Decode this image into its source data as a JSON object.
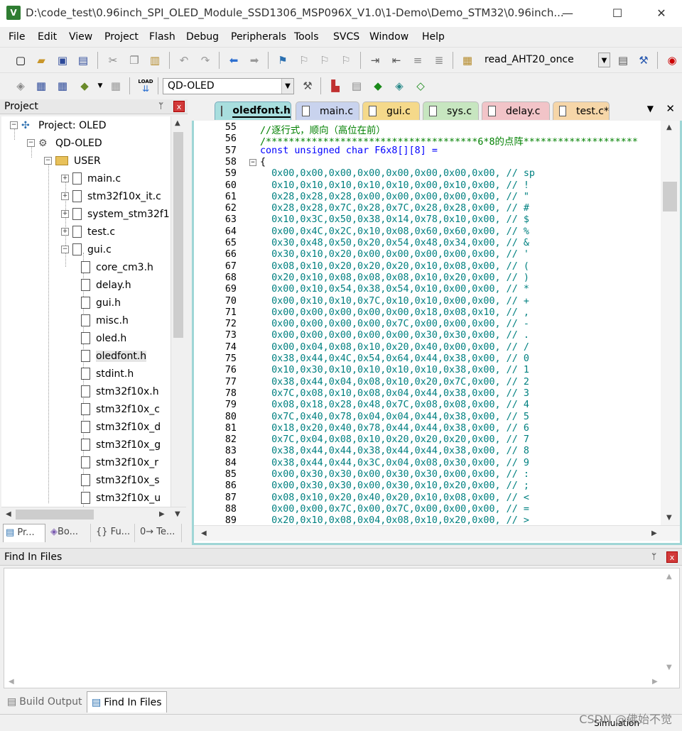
{
  "window": {
    "app_icon": "V",
    "title": "D:\\code_test\\0.96inch_SPI_OLED_Module_SSD1306_MSP096X_V1.0\\1-Demo\\Demo_STM32\\0.96inch...",
    "minimize": "—",
    "maximize": "☐",
    "close": "✕"
  },
  "menu": [
    "File",
    "Edit",
    "View",
    "Project",
    "Flash",
    "Debug",
    "Peripherals",
    "Tools",
    "SVCS",
    "Window",
    "Help"
  ],
  "toolbar1": {
    "target_combo": "read_AHT20_once"
  },
  "toolbar2": {
    "load_label": "LOAD",
    "target_combo": "QD-OLED"
  },
  "project_panel": {
    "title": "Project",
    "pin": "ᛘ",
    "close": "x",
    "tree": [
      {
        "label": "Project: OLED",
        "kind": "project",
        "expander": "−"
      },
      {
        "label": "QD-OLED",
        "kind": "target",
        "expander": "−"
      },
      {
        "label": "USER",
        "kind": "folder",
        "expander": "−"
      },
      {
        "label": "main.c",
        "kind": "file",
        "expander": "+"
      },
      {
        "label": "stm32f10x_it.c",
        "kind": "file",
        "expander": "+"
      },
      {
        "label": "system_stm32f1",
        "kind": "file",
        "expander": "+"
      },
      {
        "label": "test.c",
        "kind": "file",
        "expander": "+"
      },
      {
        "label": "gui.c",
        "kind": "file",
        "expander": "−"
      },
      {
        "label": "core_cm3.h",
        "kind": "header"
      },
      {
        "label": "delay.h",
        "kind": "header"
      },
      {
        "label": "gui.h",
        "kind": "header"
      },
      {
        "label": "misc.h",
        "kind": "header"
      },
      {
        "label": "oled.h",
        "kind": "header"
      },
      {
        "label": "oledfont.h",
        "kind": "header",
        "selected": true
      },
      {
        "label": "stdint.h",
        "kind": "header"
      },
      {
        "label": "stm32f10x.h",
        "kind": "header"
      },
      {
        "label": "stm32f10x_c",
        "kind": "header"
      },
      {
        "label": "stm32f10x_d",
        "kind": "header"
      },
      {
        "label": "stm32f10x_g",
        "kind": "header"
      },
      {
        "label": "stm32f10x_r",
        "kind": "header"
      },
      {
        "label": "stm32f10x_s",
        "kind": "header"
      },
      {
        "label": "stm32f10x_u",
        "kind": "header"
      }
    ],
    "tabs": [
      "Pr...",
      "Bo...",
      "{} Fu...",
      "0→ Te..."
    ]
  },
  "editor": {
    "tabs": [
      {
        "label": "oledfont.h",
        "color": "#a8dede",
        "active": true
      },
      {
        "label": "main.c",
        "color": "#c9d3ee"
      },
      {
        "label": "gui.c",
        "color": "#f5d98a"
      },
      {
        "label": "sys.c",
        "color": "#c7e6c0"
      },
      {
        "label": "delay.c",
        "color": "#f2c4c8"
      },
      {
        "label": "test.c*",
        "color": "#f6d6a8"
      }
    ],
    "tab_menu": "▼",
    "tab_close": "✕",
    "lines": [
      {
        "n": "55",
        "text": "//逐行式，顺向（高位在前）",
        "style": "comment"
      },
      {
        "n": "56",
        "text": "/*************************************6*8的点阵********************",
        "style": "comment"
      },
      {
        "n": "57",
        "text": "const unsigned char F6x8[][8] =",
        "style": "decl"
      },
      {
        "n": "58",
        "text": "{",
        "style": "plain",
        "fold": "−"
      },
      {
        "n": "59",
        "text": "  0x00,0x00,0x00,0x00,0x00,0x00,0x00,0x00, // sp",
        "style": "hex"
      },
      {
        "n": "60",
        "text": "  0x10,0x10,0x10,0x10,0x10,0x00,0x10,0x00, // !",
        "style": "hex"
      },
      {
        "n": "61",
        "text": "  0x28,0x28,0x28,0x00,0x00,0x00,0x00,0x00, // \"",
        "style": "hex"
      },
      {
        "n": "62",
        "text": "  0x28,0x28,0x7C,0x28,0x7C,0x28,0x28,0x00, // #",
        "style": "hex"
      },
      {
        "n": "63",
        "text": "  0x10,0x3C,0x50,0x38,0x14,0x78,0x10,0x00, // $",
        "style": "hex"
      },
      {
        "n": "64",
        "text": "  0x00,0x4C,0x2C,0x10,0x08,0x60,0x60,0x00, // %",
        "style": "hex"
      },
      {
        "n": "65",
        "text": "  0x30,0x48,0x50,0x20,0x54,0x48,0x34,0x00, // &",
        "style": "hex"
      },
      {
        "n": "66",
        "text": "  0x30,0x10,0x20,0x00,0x00,0x00,0x00,0x00, // '",
        "style": "hex"
      },
      {
        "n": "67",
        "text": "  0x08,0x10,0x20,0x20,0x20,0x10,0x08,0x00, // (",
        "style": "hex"
      },
      {
        "n": "68",
        "text": "  0x20,0x10,0x08,0x08,0x08,0x10,0x20,0x00, // )",
        "style": "hex"
      },
      {
        "n": "69",
        "text": "  0x00,0x10,0x54,0x38,0x54,0x10,0x00,0x00, // *",
        "style": "hex"
      },
      {
        "n": "70",
        "text": "  0x00,0x10,0x10,0x7C,0x10,0x10,0x00,0x00, // +",
        "style": "hex"
      },
      {
        "n": "71",
        "text": "  0x00,0x00,0x00,0x00,0x00,0x18,0x08,0x10, // ,",
        "style": "hex"
      },
      {
        "n": "72",
        "text": "  0x00,0x00,0x00,0x00,0x7C,0x00,0x00,0x00, // -",
        "style": "hex"
      },
      {
        "n": "73",
        "text": "  0x00,0x00,0x00,0x00,0x00,0x30,0x30,0x00, // .",
        "style": "hex"
      },
      {
        "n": "74",
        "text": "  0x00,0x04,0x08,0x10,0x20,0x40,0x00,0x00, // /",
        "style": "hex"
      },
      {
        "n": "75",
        "text": "  0x38,0x44,0x4C,0x54,0x64,0x44,0x38,0x00, // 0",
        "style": "hex"
      },
      {
        "n": "76",
        "text": "  0x10,0x30,0x10,0x10,0x10,0x10,0x38,0x00, // 1",
        "style": "hex"
      },
      {
        "n": "77",
        "text": "  0x38,0x44,0x04,0x08,0x10,0x20,0x7C,0x00, // 2",
        "style": "hex"
      },
      {
        "n": "78",
        "text": "  0x7C,0x08,0x10,0x08,0x04,0x44,0x38,0x00, // 3",
        "style": "hex"
      },
      {
        "n": "79",
        "text": "  0x08,0x18,0x28,0x48,0x7C,0x08,0x08,0x00, // 4",
        "style": "hex"
      },
      {
        "n": "80",
        "text": "  0x7C,0x40,0x78,0x04,0x04,0x44,0x38,0x00, // 5",
        "style": "hex"
      },
      {
        "n": "81",
        "text": "  0x18,0x20,0x40,0x78,0x44,0x44,0x38,0x00, // 6",
        "style": "hex"
      },
      {
        "n": "82",
        "text": "  0x7C,0x04,0x08,0x10,0x20,0x20,0x20,0x00, // 7",
        "style": "hex"
      },
      {
        "n": "83",
        "text": "  0x38,0x44,0x44,0x38,0x44,0x44,0x38,0x00, // 8",
        "style": "hex"
      },
      {
        "n": "84",
        "text": "  0x38,0x44,0x44,0x3C,0x04,0x08,0x30,0x00, // 9",
        "style": "hex"
      },
      {
        "n": "85",
        "text": "  0x00,0x30,0x30,0x00,0x30,0x30,0x00,0x00, // :",
        "style": "hex"
      },
      {
        "n": "86",
        "text": "  0x00,0x30,0x30,0x00,0x30,0x10,0x20,0x00, // ;",
        "style": "hex"
      },
      {
        "n": "87",
        "text": "  0x08,0x10,0x20,0x40,0x20,0x10,0x08,0x00, // <",
        "style": "hex"
      },
      {
        "n": "88",
        "text": "  0x00,0x00,0x7C,0x00,0x7C,0x00,0x00,0x00, // =",
        "style": "hex"
      },
      {
        "n": "89",
        "text": "  0x20,0x10,0x08,0x04,0x08,0x10,0x20,0x00, // >",
        "style": "hex"
      }
    ]
  },
  "find_panel": {
    "title": "Find In Files",
    "pin": "ᛘ",
    "close": "x"
  },
  "bottom_tabs": [
    "Build Output",
    "Find In Files"
  ],
  "status": {
    "mode": "Simulation"
  },
  "watermark": "CSDN @佛始不觉"
}
